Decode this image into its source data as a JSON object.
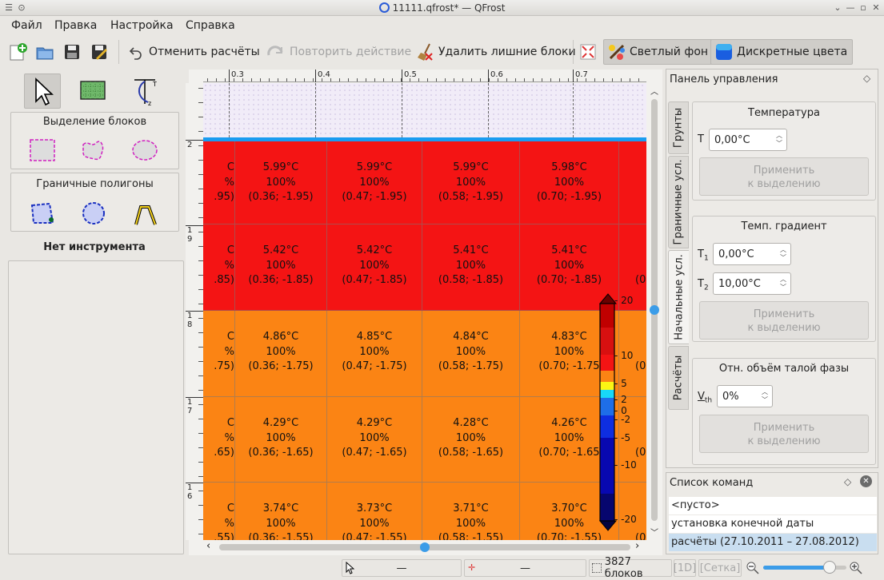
{
  "window": {
    "title": "11111.qfrost* — QFrost"
  },
  "menu": [
    "Файл",
    "Правка",
    "Настройка",
    "Справка"
  ],
  "toolbar": {
    "undo": "Отменить расчёты",
    "redo": "Повторить действие",
    "remove": "Удалить лишние блоки",
    "light_bg": "Светлый фон",
    "discrete": "Дискретные цвета"
  },
  "tools": {
    "selection_title": "Выделение блоков",
    "polygons_title": "Граничные полигоны",
    "no_tool": "Нет инструмента"
  },
  "rulers": {
    "h_ticks": [
      "0.3",
      "0.4",
      "0.5",
      "0.6",
      "0.7"
    ],
    "v_ticks": [
      "2",
      "1\n9",
      "1\n8",
      "1\n7",
      "1\n6"
    ]
  },
  "grid": {
    "columns": [
      {
        "x": "...5)",
        "show_full": false
      },
      {
        "x": "0.36"
      },
      {
        "x": "0.47"
      },
      {
        "x": "0.58"
      },
      {
        "x": "0.70"
      }
    ],
    "rows": [
      {
        "color": "#f41414",
        "cells": [
          {
            "t": "C",
            "v": "%",
            "c": ".95)"
          },
          {
            "t": "5.99°C",
            "v": "100%",
            "c": "(0.36; -1.95)"
          },
          {
            "t": "5.99°C",
            "v": "100%",
            "c": "(0.47; -1.95)"
          },
          {
            "t": "5.99°C",
            "v": "100%",
            "c": "(0.58; -1.95)"
          },
          {
            "t": "5.98°C",
            "v": "100%",
            "c": "(0.70; -1.95)"
          },
          {
            "t": "",
            "v": "",
            "c": ""
          }
        ]
      },
      {
        "color": "#f41414",
        "cells": [
          {
            "t": "C",
            "v": "%",
            "c": ".85)"
          },
          {
            "t": "5.42°C",
            "v": "100%",
            "c": "(0.36; -1.85)"
          },
          {
            "t": "5.42°C",
            "v": "100%",
            "c": "(0.47; -1.85)"
          },
          {
            "t": "5.41°C",
            "v": "100%",
            "c": "(0.58; -1.85)"
          },
          {
            "t": "5.41°C",
            "v": "100%",
            "c": "(0.70; -1.85)"
          },
          {
            "t": "",
            "v": "",
            "c": "(0"
          }
        ]
      },
      {
        "color": "#fb8414",
        "cells": [
          {
            "t": "C",
            "v": "%",
            "c": ".75)"
          },
          {
            "t": "4.86°C",
            "v": "100%",
            "c": "(0.36; -1.75)"
          },
          {
            "t": "4.85°C",
            "v": "100%",
            "c": "(0.47; -1.75)"
          },
          {
            "t": "4.84°C",
            "v": "100%",
            "c": "(0.58; -1.75)"
          },
          {
            "t": "4.83°C",
            "v": "100%",
            "c": "(0.70; -1.75"
          },
          {
            "t": "",
            "v": "",
            "c": "(0"
          }
        ]
      },
      {
        "color": "#fb8414",
        "cells": [
          {
            "t": "C",
            "v": "%",
            "c": ".65)"
          },
          {
            "t": "4.29°C",
            "v": "100%",
            "c": "(0.36; -1.65)"
          },
          {
            "t": "4.29°C",
            "v": "100%",
            "c": "(0.47; -1.65)"
          },
          {
            "t": "4.28°C",
            "v": "100%",
            "c": "(0.58; -1.65)"
          },
          {
            "t": "4.26°C",
            "v": "100%",
            "c": "(0.70; -1.65"
          },
          {
            "t": "",
            "v": "",
            "c": "(0"
          }
        ]
      },
      {
        "color": "#fb8414",
        "cells": [
          {
            "t": "C",
            "v": "%",
            "c": ".55)"
          },
          {
            "t": "3.74°C",
            "v": "100%",
            "c": "(0.36; -1.55)"
          },
          {
            "t": "3.73°C",
            "v": "100%",
            "c": "(0.47; -1.55)"
          },
          {
            "t": "3.71°C",
            "v": "100%",
            "c": "(0.58; -1.55)"
          },
          {
            "t": "3.70°C",
            "v": "100%",
            "c": "(0.70; -1.55)"
          },
          {
            "t": "",
            "v": "",
            "c": "(0"
          }
        ]
      }
    ]
  },
  "colorscale": {
    "labels": [
      "20",
      "10",
      "5",
      "2",
      "0",
      "-2",
      "-5",
      "-10",
      "-20"
    ]
  },
  "panel": {
    "title": "Панель управления",
    "tabs": [
      "Грунты",
      "Граничные усл.",
      "Начальные усл.",
      "Расчёты"
    ],
    "temp": {
      "title": "Температура",
      "label": "T",
      "value": "0,00°C",
      "apply": "Применить\nк выделению"
    },
    "grad": {
      "title": "Темп. градиент",
      "t1_label": "T",
      "t1_sub": "1",
      "t1_value": "0,00°C",
      "t2_label": "T",
      "t2_sub": "2",
      "t2_value": "10,00°C",
      "apply": "Применить\nк выделению"
    },
    "thaw": {
      "title": "Отн. объём талой фазы",
      "label": "V",
      "label_sub": "th",
      "value": "0%",
      "apply": "Применить\nк выделению"
    }
  },
  "commands": {
    "title": "Список команд",
    "items": [
      "<пусто>",
      "установка конечной даты",
      "расчёты (27.10.2011 – 27.08.2012)"
    ],
    "selected": 2
  },
  "status": {
    "blocks": "3827 блоков",
    "dash": "—",
    "mode1d": "[1D]",
    "grid": "[Сетка]",
    "zoom": 0.8
  }
}
